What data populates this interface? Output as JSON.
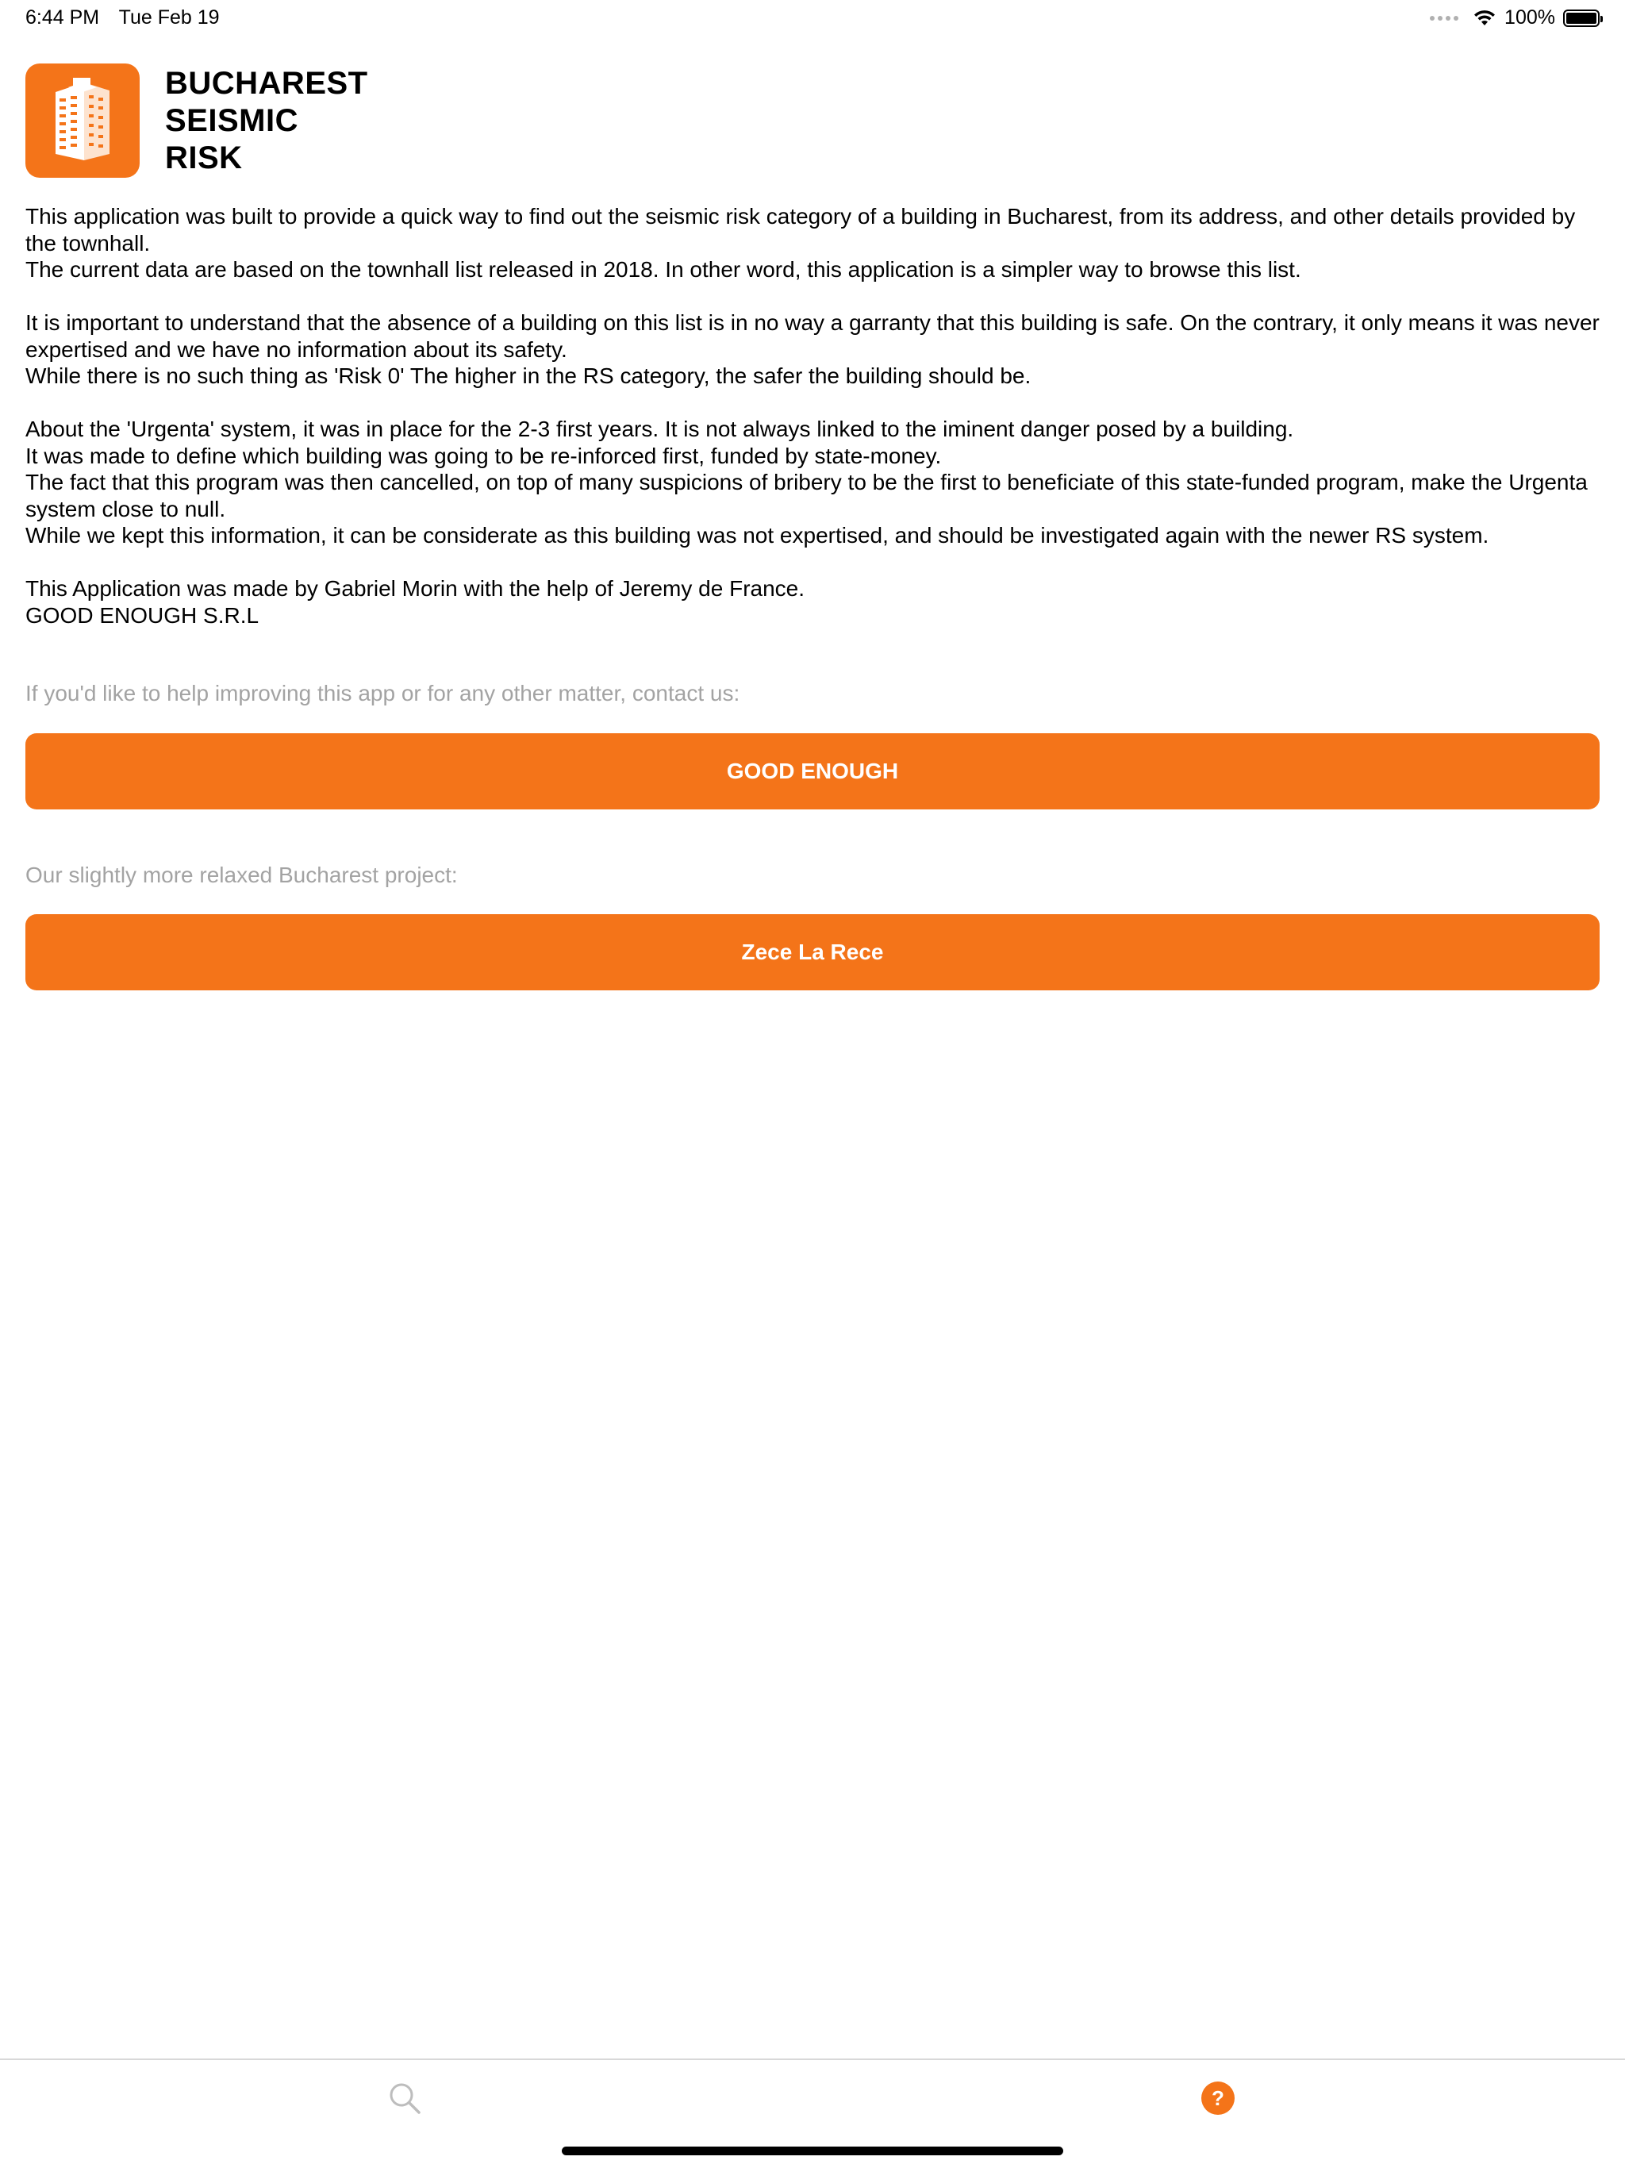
{
  "status_bar": {
    "time": "6:44 PM",
    "date": "Tue Feb 19",
    "battery": "100%"
  },
  "header": {
    "app_name_lines": [
      "BUCHAREST",
      "SEISMIC",
      "RISK"
    ],
    "icon": "building-icon"
  },
  "about": {
    "paragraphs": [
      "This application was built to provide a quick way to find out the seismic risk category of a building in Bucharest, from its address, and other details provided by the townhall.\nThe current data are based on the townhall list released in 2018. In other word, this application is a simpler way to browse this list.",
      "It is important to understand that the absence of a building on this list is in no way a garranty that this building is safe. On the contrary, it only means it was never expertised and we have no information about its safety.\nWhile there is no such thing as 'Risk 0' The higher in the RS category, the safer the building should be.",
      "About the 'Urgenta' system, it was in place for the 2-3 first years. It is not always linked to the iminent danger posed by a building.\nIt was made to define which building was going to be re-inforced first, funded by state-money.\nThe fact that this program was then cancelled, on top of many suspicions of bribery to be the first to beneficiate of this state-funded program, make the Urgenta system close to null.\nWhile we kept this information, it can be considerate as this building was not expertised, and should be investigated again with the newer RS system.",
      "This Application was made by Gabriel Morin with the help of Jeremy de France.\nGOOD ENOUGH S.R.L"
    ]
  },
  "contact": {
    "caption": "If you'd like to help improving this app or for any other matter, contact us:",
    "button_label": "GOOD ENOUGH"
  },
  "project": {
    "caption": "Our slightly more relaxed Bucharest project:",
    "button_label": "Zece La Rece"
  },
  "tab_bar": {
    "tabs": [
      {
        "icon": "search-icon",
        "active": false
      },
      {
        "icon": "help-icon",
        "label": "?",
        "active": true
      }
    ]
  },
  "colors": {
    "accent": "#F47419",
    "caption": "#A3A3A3",
    "inactive_icon": "#BDBDBD"
  }
}
